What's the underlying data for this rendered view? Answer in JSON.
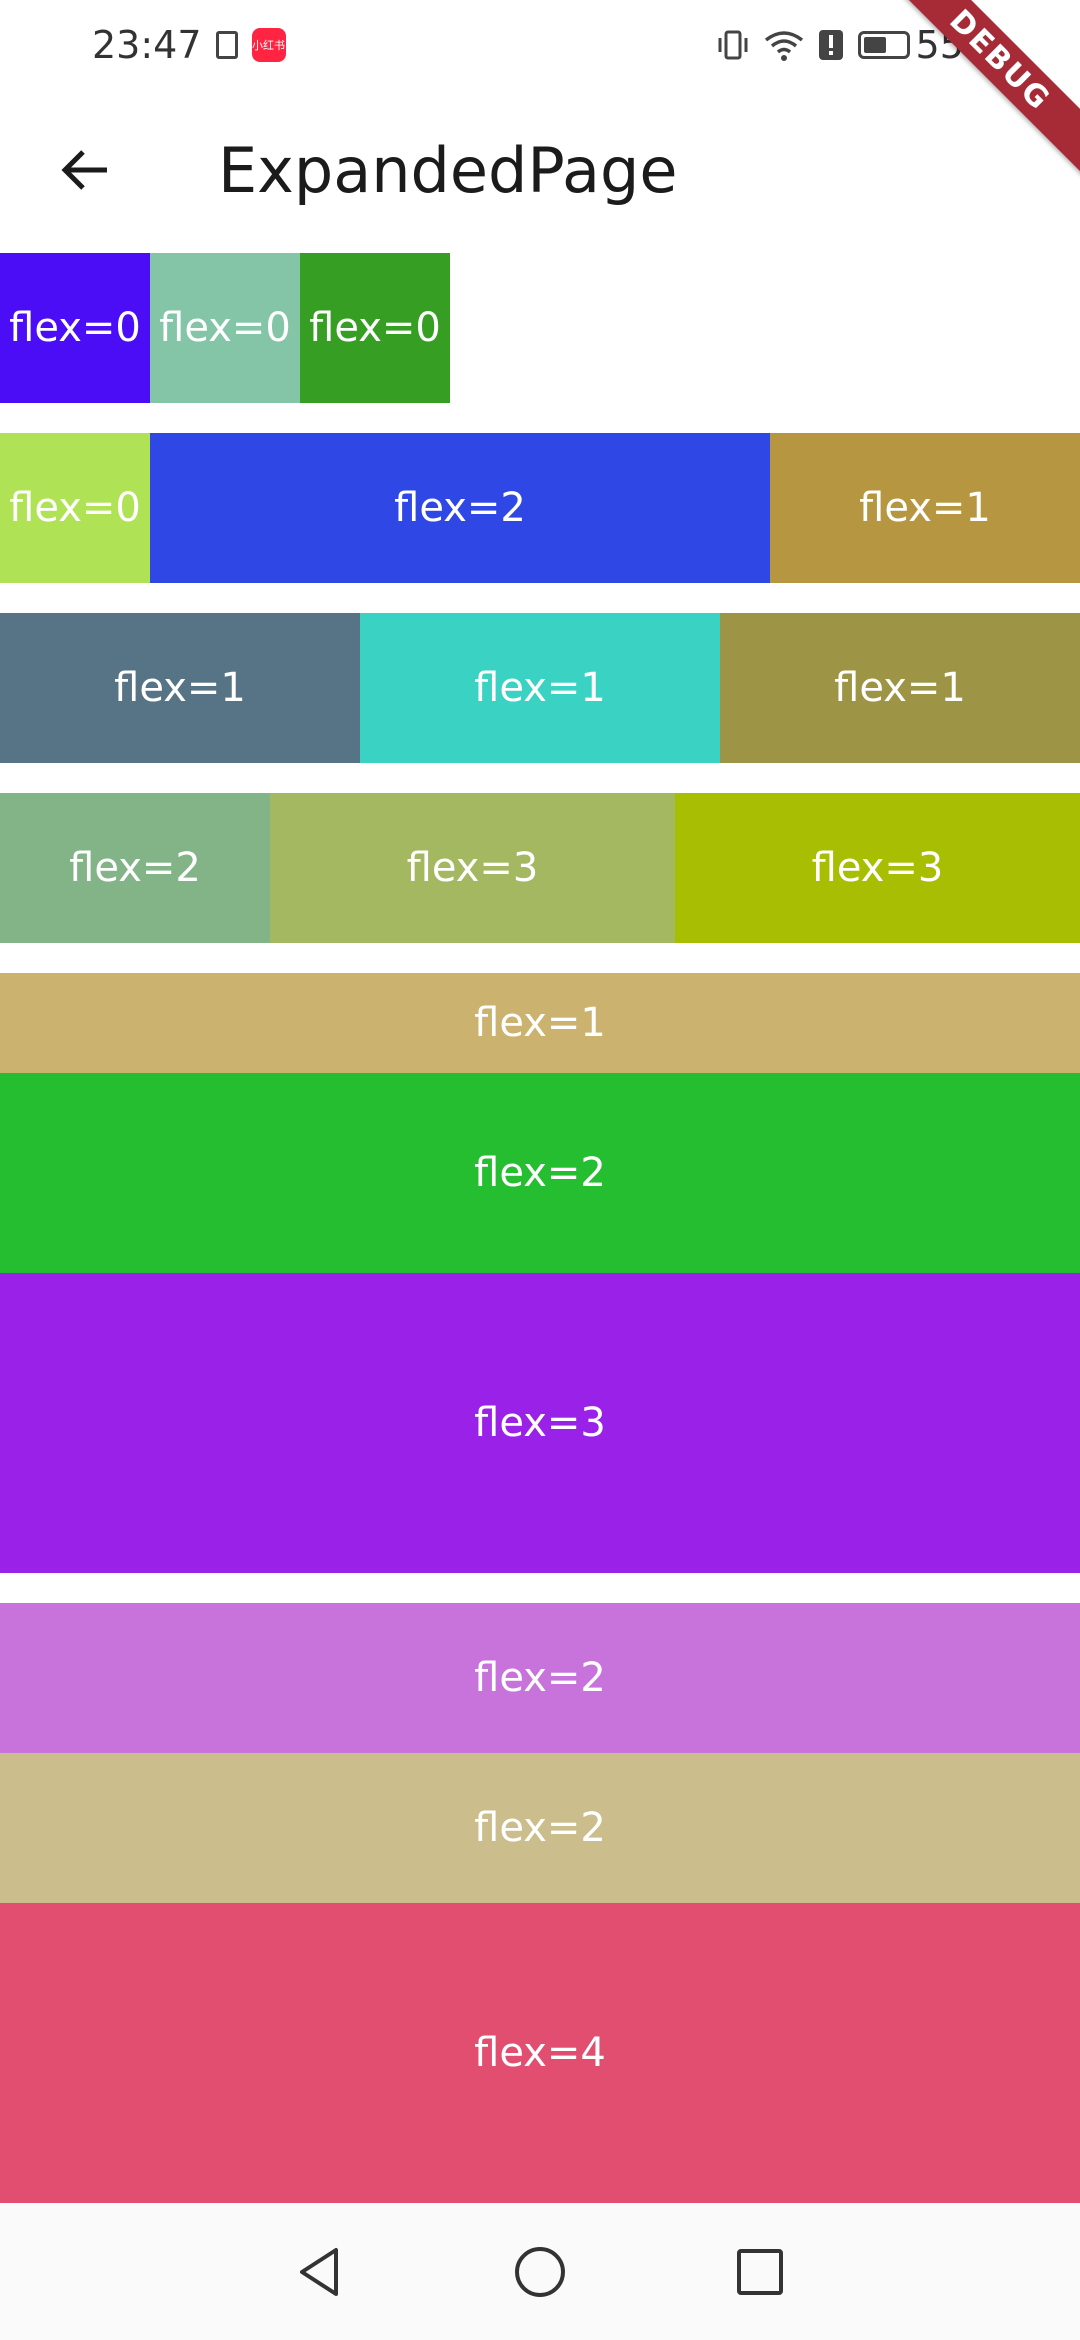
{
  "status_bar": {
    "time": "23:47",
    "notification_app": "小红书",
    "battery_percent": "55%",
    "battery_level": 0.55,
    "icons": [
      "vibrate-icon",
      "wifi-icon",
      "alert-icon",
      "battery-icon"
    ]
  },
  "debug_banner": "DEBUG",
  "app_bar": {
    "back_icon": "arrow-left-icon",
    "title": "ExpandedPage"
  },
  "rows": [
    {
      "cells": [
        {
          "label": "flex=0",
          "color": "#4a0df6"
        },
        {
          "label": "flex=0",
          "color": "#84c5a7"
        },
        {
          "label": "flex=0",
          "color": "#369f23"
        }
      ]
    },
    {
      "cells": [
        {
          "label": "flex=0",
          "color": "#b0e255"
        },
        {
          "label": "flex=2",
          "color": "#2f47e5"
        },
        {
          "label": "flex=1",
          "color": "#b79641"
        }
      ]
    },
    {
      "cells": [
        {
          "label": "flex=1",
          "color": "#567485"
        },
        {
          "label": "flex=1",
          "color": "#39d2c3"
        },
        {
          "label": "flex=1",
          "color": "#9e9445"
        }
      ]
    },
    {
      "cells": [
        {
          "label": "flex=2",
          "color": "#82b487"
        },
        {
          "label": "flex=3",
          "color": "#a4b862"
        },
        {
          "label": "flex=3",
          "color": "#a7be03"
        }
      ]
    }
  ],
  "column_a": [
    {
      "label": "flex=1",
      "color": "#cbb26e"
    },
    {
      "label": "flex=2",
      "color": "#24be30"
    },
    {
      "label": "flex=3",
      "color": "#9a22e8"
    }
  ],
  "column_b": [
    {
      "label": "flex=2",
      "color": "#c773db"
    },
    {
      "label": "flex=2",
      "color": "#ccbd8d"
    },
    {
      "label": "flex=4",
      "color": "#e24e6f"
    }
  ],
  "nav": {
    "back": "triangle-back-icon",
    "home": "circle-home-icon",
    "recents": "square-recents-icon"
  }
}
